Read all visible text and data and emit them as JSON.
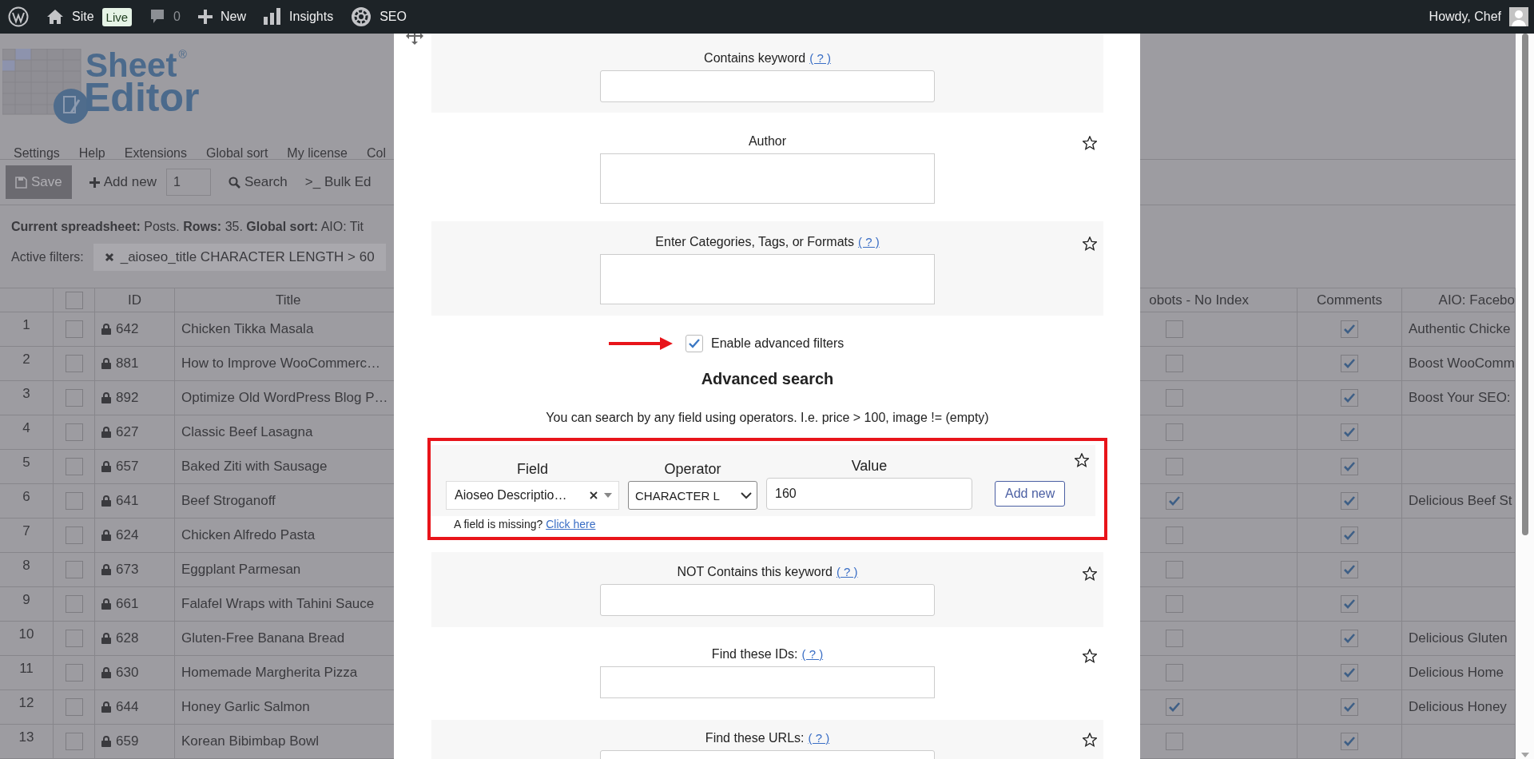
{
  "admin_bar": {
    "site": "Site",
    "live": "Live",
    "comments": "0",
    "new": "New",
    "insights": "Insights",
    "seo": "SEO",
    "user": "Howdy, Chef"
  },
  "logo": {
    "line_1": "Sheet",
    "mark": "®",
    "line_2": "Editor"
  },
  "menu": [
    "Settings",
    "Help",
    "Extensions",
    "Global sort",
    "My license",
    "Col"
  ],
  "toolbar": {
    "save": "Save",
    "add_new": "Add new",
    "count": "1",
    "search": "Search",
    "bulk_icon": ">_",
    "bulk_edit": "Bulk Ed"
  },
  "summary": "**Current spreadsheet:** Posts. **Rows:** 35. **Global sort:** AIO: Tit",
  "active_filters": {
    "label": "Active filters:",
    "chips": [
      "_aioseo_title CHARACTER LENGTH > 60"
    ]
  },
  "table": {
    "header": {
      "checked": false,
      "id": "ID",
      "title": "Title",
      "no_index": "obots - No Index",
      "comments": "Comments",
      "aio": "AIO: Facebo"
    },
    "rows": [
      {
        "n": "1",
        "checked": false,
        "id": "642",
        "title": "Chicken Tikka Masala",
        "no_index": false,
        "comments": true,
        "aio": "Authentic Chicke"
      },
      {
        "n": "2",
        "checked": false,
        "id": "881",
        "title": "How to Improve WooCommerc…",
        "no_index": false,
        "comments": true,
        "aio": "Boost WooComm"
      },
      {
        "n": "3",
        "checked": false,
        "id": "892",
        "title": "Optimize Old WordPress Blog P…",
        "no_index": false,
        "comments": true,
        "aio": "Boost Your SEO:"
      },
      {
        "n": "4",
        "checked": false,
        "id": "627",
        "title": "Classic Beef Lasagna",
        "no_index": false,
        "comments": true
      },
      {
        "n": "5",
        "checked": false,
        "id": "657",
        "title": "Baked Ziti with Sausage",
        "no_index": false,
        "comments": true
      },
      {
        "n": "6",
        "checked": false,
        "id": "641",
        "title": "Beef Stroganoff",
        "no_index": true,
        "comments": true,
        "aio": "Delicious Beef St"
      },
      {
        "n": "7",
        "checked": false,
        "id": "624",
        "title": "Chicken Alfredo Pasta",
        "no_index": false,
        "comments": true
      },
      {
        "n": "8",
        "checked": false,
        "id": "673",
        "title": "Eggplant Parmesan",
        "no_index": false,
        "comments": true
      },
      {
        "n": "9",
        "checked": false,
        "id": "661",
        "title": "Falafel Wraps with Tahini Sauce",
        "no_index": false,
        "comments": true
      },
      {
        "n": "10",
        "checked": false,
        "id": "628",
        "title": "Gluten-Free Banana Bread",
        "no_index": false,
        "comments": true,
        "aio": "Delicious Gluten"
      },
      {
        "n": "11",
        "checked": false,
        "id": "630",
        "title": "Homemade Margherita Pizza",
        "no_index": false,
        "comments": true,
        "aio": "Delicious Home"
      },
      {
        "n": "12",
        "checked": false,
        "id": "644",
        "title": "Honey Garlic Salmon",
        "no_index": true,
        "comments": true,
        "aio": "Delicious Honey"
      },
      {
        "n": "13",
        "checked": false,
        "id": "659",
        "title": "Korean Bibimbap Bowl",
        "no_index": false,
        "comments": true
      }
    ]
  },
  "modal": {
    "sections_before": [
      {
        "kind": "input",
        "label": "Contains keyword",
        "help": "( ? )"
      },
      {
        "kind": "textarea",
        "label": "Author",
        "pinned": false
      },
      {
        "kind": "textarea",
        "label": "Enter Categories, Tags, or Formats",
        "help": "( ? )",
        "pinned": false
      }
    ],
    "advanced": {
      "toggle_label": "Enable advanced filters",
      "enabled": true,
      "heading": "Advanced search",
      "description": "You can search by any field using operators. I.e. price > 100, image != (empty)",
      "field_label": "Field",
      "operator_label": "Operator",
      "value_label": "Value",
      "field": "Aioseo Descriptio…",
      "operator": "CHARACTER L",
      "value": "160",
      "add_button": "Add new",
      "missing_text": "A field is missing?",
      "missing_link": "Click here",
      "pinned": false
    },
    "sections_after": [
      {
        "kind": "input",
        "label": "NOT Contains this keyword",
        "help": "( ? )",
        "pinned": false
      },
      {
        "kind": "textarea",
        "label": "Find these IDs:",
        "help": "( ? )",
        "pinned": false
      },
      {
        "kind": "input",
        "label": "Find these URLs:",
        "help": "( ? )",
        "pinned": false
      }
    ]
  }
}
